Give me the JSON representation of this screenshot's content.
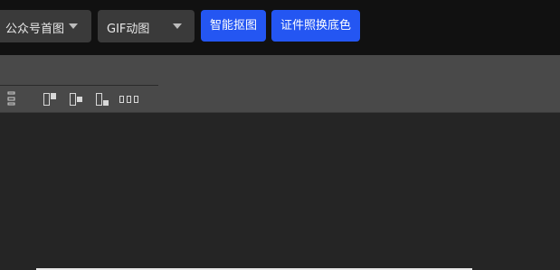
{
  "toolbar": {
    "dropdown_wechat_cover": "公众号首图",
    "dropdown_gif": "GIF动图",
    "btn_smart_matting": "智能抠图",
    "btn_id_photo_bg": "证件照换底色"
  },
  "align_tools": {
    "icons": [
      "distribute-vertical-icon",
      "align-top-icon",
      "align-middle-icon",
      "align-bottom-icon",
      "distribute-horizontal-icon"
    ]
  },
  "colors": {
    "accent_blue": "#2456f2",
    "topbar_bg": "#111111",
    "panel_bg": "#494949",
    "canvas_bg": "#252525"
  }
}
